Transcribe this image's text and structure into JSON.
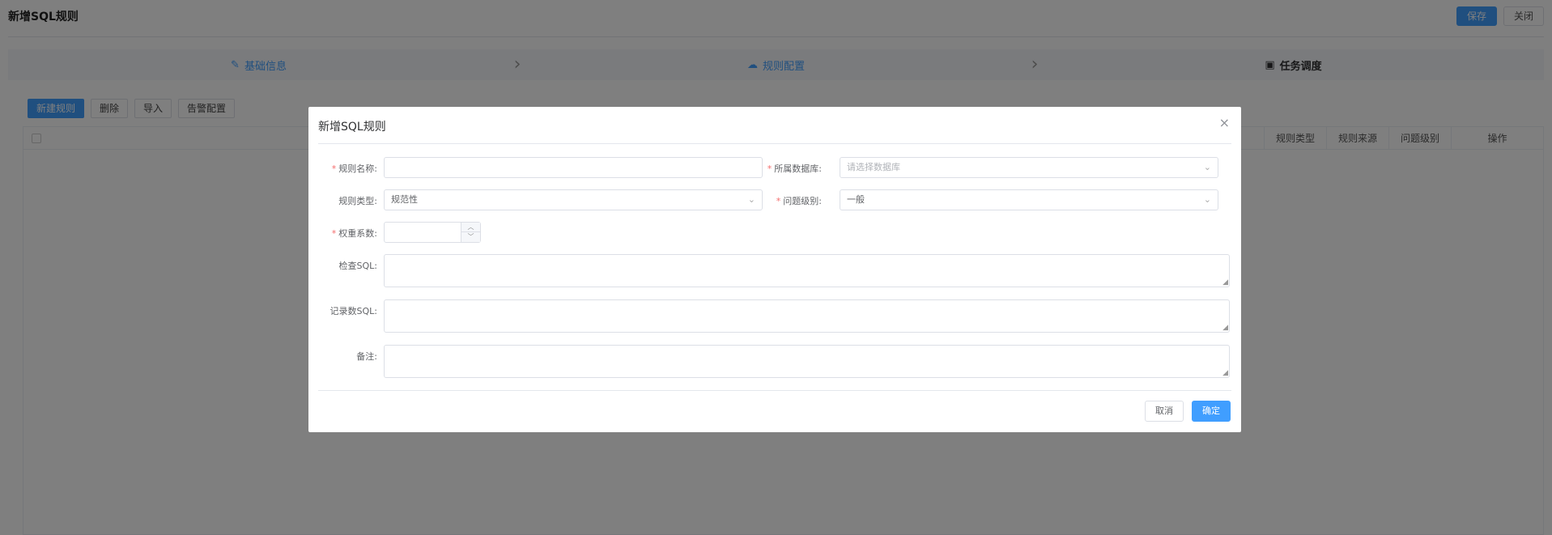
{
  "page": {
    "title": "新增SQL规则",
    "save_label": "保存",
    "close_label": "关闭"
  },
  "steps": [
    {
      "label": "基础信息",
      "icon": "edit-icon"
    },
    {
      "label": "规则配置",
      "icon": "cloud-upload-icon"
    },
    {
      "label": "任务调度",
      "icon": "image-icon"
    }
  ],
  "toolbar": {
    "new_rule": "新建规则",
    "delete": "删除",
    "import": "导入",
    "alarm_config": "告警配置"
  },
  "table": {
    "columns": [
      "规则类型",
      "规则来源",
      "问题级别",
      "操作"
    ]
  },
  "dialog": {
    "title": "新增SQL规则",
    "close_glyph": "×",
    "fields": {
      "rule_name": {
        "label": "规则名称:",
        "value": "",
        "required": true
      },
      "database": {
        "label": "所属数据库:",
        "placeholder": "请选择数据库",
        "required": true
      },
      "rule_type": {
        "label": "规则类型:",
        "value": "规范性",
        "required": false
      },
      "issue_level": {
        "label": "问题级别:",
        "value": "一般",
        "required": true
      },
      "weight": {
        "label": "权重系数:",
        "value": "",
        "required": true
      },
      "check_sql": {
        "label": "检查SQL:",
        "value": ""
      },
      "record_sql": {
        "label": "记录数SQL:",
        "value": ""
      },
      "remark": {
        "label": "备注:",
        "value": ""
      }
    },
    "cancel_label": "取消",
    "confirm_label": "确定"
  },
  "colors": {
    "primary": "#409eff",
    "required": "#f56c6c",
    "overlay": "rgba(0,0,0,0.5)"
  }
}
